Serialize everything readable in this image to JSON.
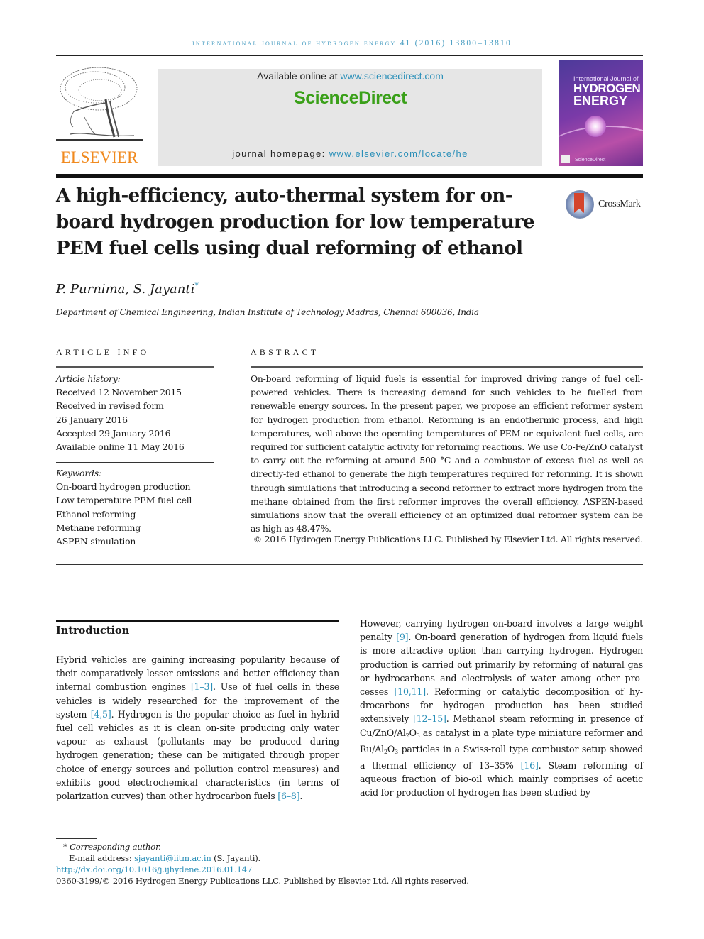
{
  "journal_header": "International Journal of Hydrogen Energy 41 (2016) 13800–13810",
  "publisher": {
    "logo_text": "ELSEVIER"
  },
  "banner": {
    "available_prefix": "Available online at ",
    "available_link": "www.sciencedirect.com",
    "brand": "ScienceDirect",
    "homepage_prefix": "journal homepage: ",
    "homepage_link": "www.elsevier.com/locate/he"
  },
  "cover": {
    "line1": "International Journal of",
    "line2": "HYDROGEN",
    "line3": "ENERGY",
    "footer": "ScienceDirect"
  },
  "article": {
    "title": "A high-efficiency, auto-thermal system for on-board hydrogen production for low temperature PEM fuel cells using dual reforming of ethanol",
    "crossmark_label": "CrossMark",
    "authors": "P. Purnima, S. Jayanti",
    "corresponding_marker": "*",
    "affiliation": "Department of Chemical Engineering, Indian Institute of Technology Madras, Chennai 600036, India"
  },
  "article_info": {
    "heading": "ARTICLE INFO",
    "history_label": "Article history:",
    "history": [
      "Received 12 November 2015",
      "Received in revised form",
      "26 January 2016",
      "Accepted 29 January 2016",
      "Available online 11 May 2016"
    ],
    "keywords_label": "Keywords:",
    "keywords": [
      "On-board hydrogen production",
      "Low temperature PEM fuel cell",
      "Ethanol reforming",
      "Methane reforming",
      "ASPEN simulation"
    ]
  },
  "abstract": {
    "heading": "ABSTRACT",
    "text": "On-board reforming of liquid fuels is essential for improved driving range of fuel cell-powered vehicles. There is increasing demand for such vehicles to be fuelled from renewable energy sources. In the present paper, we propose an efficient reformer system for hydrogen production from ethanol. Reforming is an endothermic process, and high temperatures, well above the operating temperatures of PEM or equivalent fuel cells, are required for sufficient catalytic activity for reforming reactions. We use Co-Fe/ZnO catalyst to carry out the reforming at around 500 °C and a combustor of excess fuel as well as directly-fed ethanol to generate the high temperatures required for reforming. It is shown through simulations that introducing a second reformer to extract more hydrogen from the methane obtained from the first reformer improves the overall efficiency. ASPEN-based simulations show that the overall efficiency of an optimized dual reformer system can be as high as 48.47%.",
    "copyright": "© 2016 Hydrogen Energy Publications LLC. Published by Elsevier Ltd. All rights reserved."
  },
  "introduction": {
    "heading": "Introduction",
    "col1": [
      {
        "t": "Hybrid vehicles are gaining increasing popularity because of their comparatively lesser emissions and better efficiency than internal combustion engines "
      },
      {
        "ref": "[1–3]"
      },
      {
        "t": ". Use of fuel cells in these vehicles is widely researched for the improvement of the system "
      },
      {
        "ref": "[4,5]"
      },
      {
        "t": ". Hydrogen is the popular choice as fuel in hybrid fuel cell vehicles as it is clean on-site producing only water vapour as exhaust (pollutants may be produced during hydrogen generation; these can be mitigated through proper choice of energy sources and pollution control measures) and exhibits good electrochemical characteristics (in terms of polarization curves) than other hydrocarbon fuels "
      },
      {
        "ref": "[6–8]"
      },
      {
        "t": "."
      }
    ],
    "col2": [
      {
        "t": "However, carrying hydrogen on-board involves a large weight penalty "
      },
      {
        "ref": "[9]"
      },
      {
        "t": ". On-board generation of hydrogen from liquid fuels is more attractive option than carrying hydrogen. Hydrogen production is carried out primarily by reforming of natural gas or hydrocarbons and electrolysis of water among other pro­cesses "
      },
      {
        "ref": "[10,11]"
      },
      {
        "t": ". Reforming or catalytic decomposition of hy­drocarbons for hydrogen production has been studied extensively "
      },
      {
        "ref": "[12–15]"
      },
      {
        "t": ". Methanol steam reforming in presence of Cu/ZnO/Al"
      },
      {
        "sub": "2"
      },
      {
        "t": "O"
      },
      {
        "sub": "3"
      },
      {
        "t": " as catalyst in a plate type miniature reformer and Ru/Al"
      },
      {
        "sub": "2"
      },
      {
        "t": "O"
      },
      {
        "sub": "3"
      },
      {
        "t": " particles in a Swiss-roll type combustor setup showed a thermal efficiency of 13–35% "
      },
      {
        "ref": "[16]"
      },
      {
        "t": ". Steam reforming of aqueous fraction of bio-oil which mainly comprises of acetic acid for production of hydrogen has been studied by"
      }
    ]
  },
  "footnotes": {
    "corresponding": "* Corresponding author.",
    "email_label": "E-mail address: ",
    "email": "sjayanti@iitm.ac.in",
    "email_suffix": " (S. Jayanti).",
    "doi": "http://dx.doi.org/10.1016/j.ijhydene.2016.01.147",
    "issn_copyright": "0360-3199/© 2016 Hydrogen Energy Publications LLC. Published by Elsevier Ltd. All rights reserved."
  },
  "colors": {
    "link": "#2a8fb8",
    "sciencedirect_green": "#3aa019",
    "elsevier_orange": "#f08a1f"
  }
}
